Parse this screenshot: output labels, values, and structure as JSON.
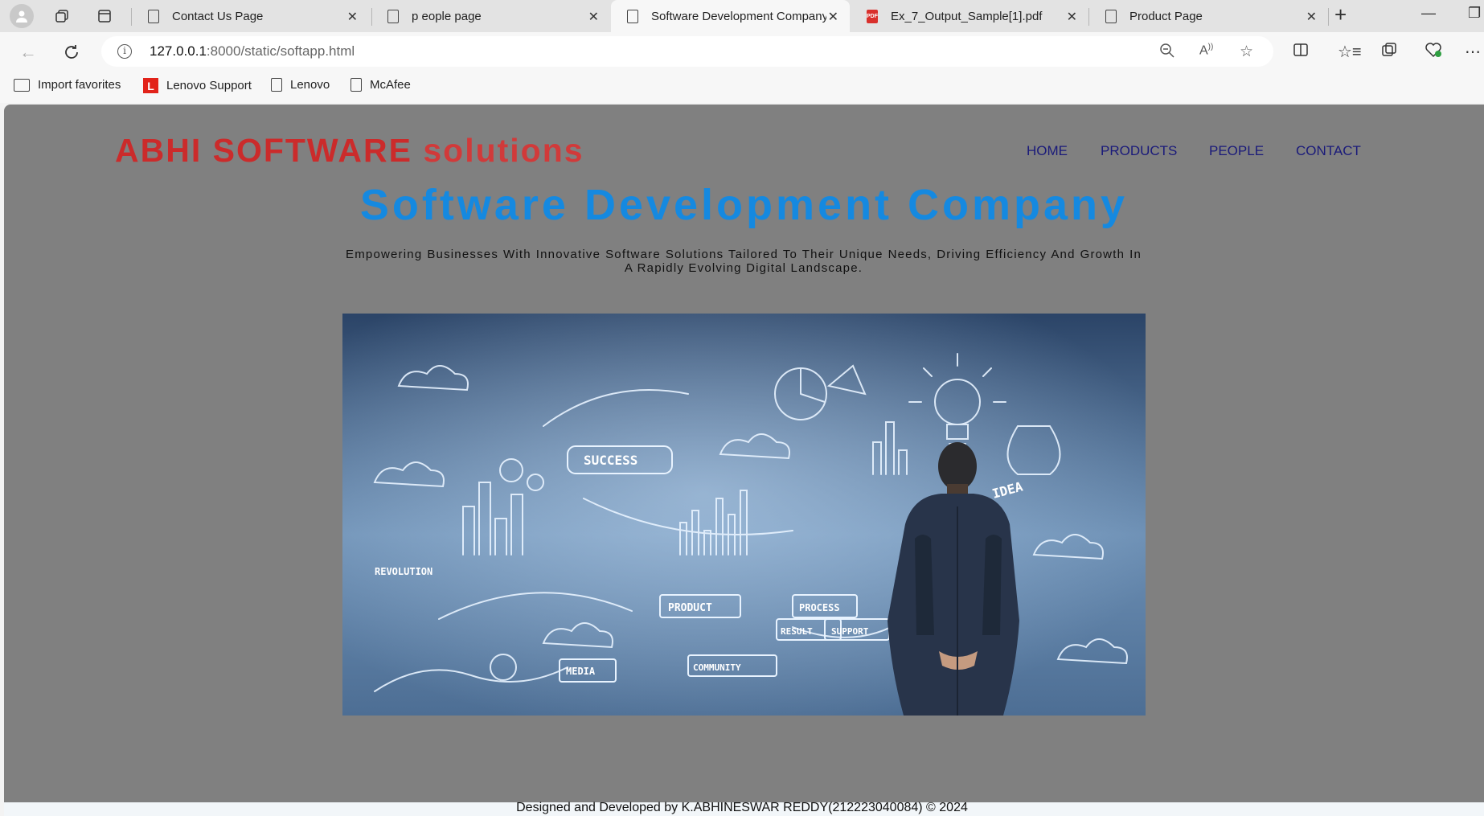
{
  "browser": {
    "tabs": [
      {
        "title": "Contact Us Page",
        "active": false
      },
      {
        "title": "p eople page",
        "active": false
      },
      {
        "title": "Software Development Company",
        "active": true
      },
      {
        "title": "Ex_7_Output_Sample[1].pdf",
        "active": false,
        "icon": "pdf-icon"
      },
      {
        "title": "Product Page",
        "active": false
      }
    ],
    "new_tab_label": "+",
    "url_host": "127.0.0.1",
    "url_rest": ":8000/static/softapp.html",
    "favorites": [
      {
        "label": "Import favorites",
        "icon": "import-favorites-icon"
      },
      {
        "label": "Lenovo Support",
        "icon": "lenovo-logo-icon"
      },
      {
        "label": "Lenovo",
        "icon": "page-icon"
      },
      {
        "label": "McAfee",
        "icon": "page-icon"
      }
    ]
  },
  "page": {
    "brand_strong": "ABHI SOFTWARE",
    "brand_light": "solutions",
    "nav": [
      "HOME",
      "PRODUCTS",
      "PEOPLE",
      "CONTACT"
    ],
    "hero_title": "Software Development Company",
    "hero_subtitle": "Empowering Businesses With Innovative Software Solutions Tailored To Their Unique Needs, Driving Efficiency And Growth In A Rapidly Evolving Digital Landscape.",
    "hero_image_text": [
      "SUCCESS",
      "IDEA",
      "PRODUCT",
      "PROCESS",
      "MEDIA",
      "COMMUNITY",
      "RESULT",
      "REVOLUTION",
      "SUPPORT"
    ],
    "footer": "Designed and Developed by K.ABHINESWAR REDDY(212223040084) © 2024"
  },
  "colors": {
    "page_bg": "#808080",
    "brand": "#cb2b2b",
    "hero_title": "#1589e0",
    "nav": "#1a1a7a"
  }
}
